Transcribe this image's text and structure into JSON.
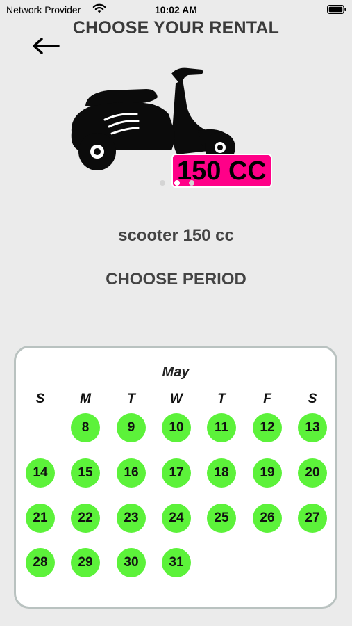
{
  "status_bar": {
    "carrier": "Network Provider",
    "time": "10:02 AM",
    "wifi_icon": "wifi-icon",
    "battery_icon": "battery-icon"
  },
  "header": {
    "title": "CHOOSE YOUR RENTAL",
    "back_icon": "arrow-left-icon"
  },
  "carousel": {
    "image": "scooter-silhouette",
    "badge": "150 CC",
    "badge_color": "#ff0088",
    "dots_count": 3,
    "active_dot": 1
  },
  "vehicle_name": "scooter 150 cc",
  "period_heading": "CHOOSE PERIOD",
  "calendar": {
    "month": "May",
    "weekdays": [
      "S",
      "M",
      "T",
      "W",
      "T",
      "F",
      "S"
    ],
    "available_color": "#5cf23a",
    "weeks": [
      [
        "",
        "8",
        "9",
        "10",
        "11",
        "12",
        "13"
      ],
      [
        "14",
        "15",
        "16",
        "17",
        "18",
        "19",
        "20"
      ],
      [
        "21",
        "22",
        "23",
        "24",
        "25",
        "26",
        "27"
      ],
      [
        "28",
        "29",
        "30",
        "31",
        "",
        "",
        ""
      ]
    ]
  }
}
